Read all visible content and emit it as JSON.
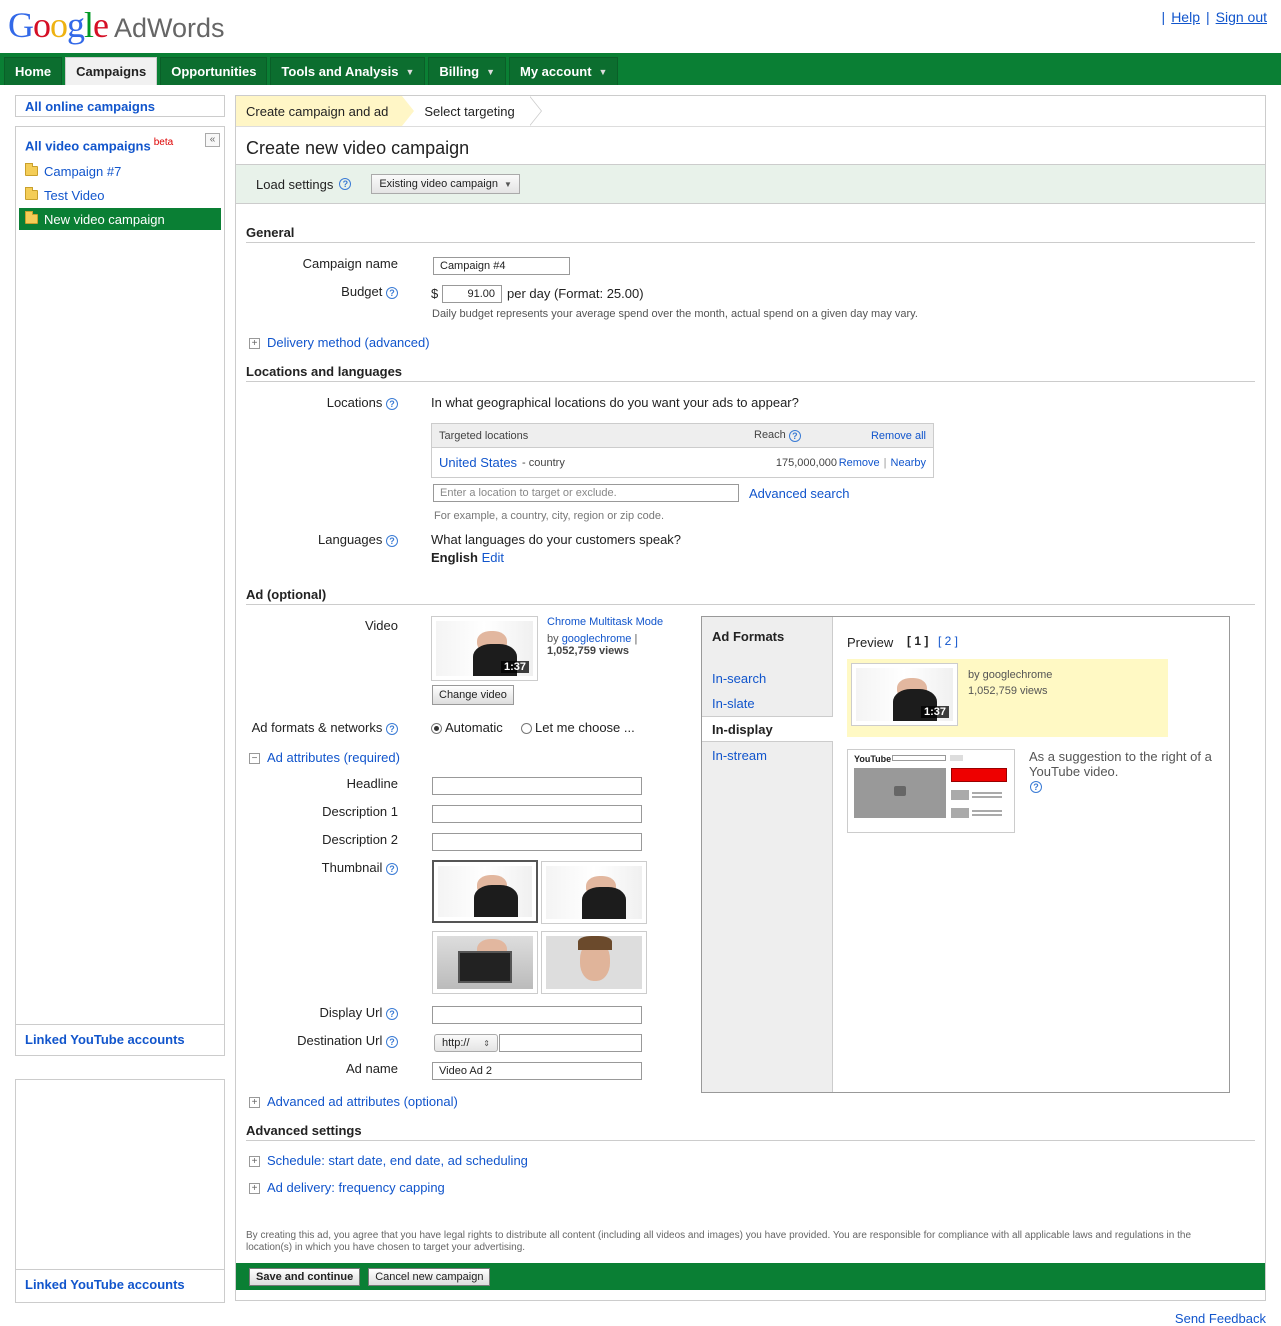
{
  "header": {
    "logo_google": "Google",
    "logo_product": "AdWords",
    "help": "Help",
    "signout": "Sign out"
  },
  "nav": {
    "tabs": [
      {
        "label": "Home"
      },
      {
        "label": "Campaigns"
      },
      {
        "label": "Opportunities"
      },
      {
        "label": "Tools and Analysis"
      },
      {
        "label": "Billing"
      },
      {
        "label": "My account"
      }
    ]
  },
  "sidebar": {
    "all_online": "All online campaigns",
    "all_video": "All video campaigns",
    "beta": "beta",
    "items": [
      {
        "label": "Campaign #7"
      },
      {
        "label": "Test Video"
      },
      {
        "label": "New video campaign"
      }
    ],
    "linked": "Linked YouTube accounts",
    "linked2": "Linked YouTube accounts"
  },
  "breadcrumbs": {
    "step1": "Create campaign and ad",
    "step2": "Select targeting"
  },
  "page": {
    "title": "Create new video campaign",
    "load_settings": "Load settings",
    "load_dropdown": "Existing video campaign"
  },
  "general": {
    "heading": "General",
    "campaign_name_label": "Campaign name",
    "campaign_name_value": "Campaign #4",
    "budget_label": "Budget",
    "currency": "$",
    "budget_value": "91.00",
    "budget_suffix": "per day (Format: 25.00)",
    "budget_note": "Daily budget represents your average spend over the month, actual spend on a given day may vary.",
    "delivery": "Delivery method (advanced)"
  },
  "locations": {
    "heading": "Locations and languages",
    "label": "Locations",
    "question": "In what geographical locations do you want your ads to appear?",
    "col_targeted": "Targeted locations",
    "col_reach": "Reach",
    "remove_all": "Remove all",
    "row_name": "United States",
    "row_type": "- country",
    "row_reach": "175,000,000",
    "remove": "Remove",
    "sep": "|",
    "nearby": "Nearby",
    "input_placeholder": "Enter a location to target or exclude.",
    "advanced_search": "Advanced search",
    "example": "For example, a country, city, region or zip code.",
    "languages_label": "Languages",
    "languages_question": "What languages do your customers speak?",
    "language": "English",
    "edit": "Edit"
  },
  "ad": {
    "heading": "Ad (optional)",
    "video_label": "Video",
    "video_title": "Chrome Multitask Mode",
    "by": "by",
    "channel": "googlechrome",
    "pipe": "|",
    "views": "1,052,759 views",
    "duration": "1:37",
    "change_video": "Change video",
    "formats_label": "Ad formats & networks",
    "automatic": "Automatic",
    "let_me_choose": "Let me choose ...",
    "attributes": "Ad attributes (required)",
    "headline_label": "Headline",
    "desc1_label": "Description 1",
    "desc2_label": "Description 2",
    "thumbnail_label": "Thumbnail",
    "display_url_label": "Display Url",
    "dest_url_label": "Destination Url",
    "protocol": "http://",
    "ad_name_label": "Ad name",
    "ad_name_value": "Video Ad 2",
    "advanced_attrs": "Advanced ad attributes (optional)"
  },
  "formats": {
    "heading": "Ad Formats",
    "items": [
      {
        "label": "In-search"
      },
      {
        "label": "In-slate"
      },
      {
        "label": "In-display"
      },
      {
        "label": "In-stream"
      }
    ],
    "preview": "Preview",
    "page1": "[ 1 ]",
    "page2": "[ 2 ]",
    "preview_by": "by googlechrome",
    "preview_views": "1,052,759 views",
    "preview_duration": "1:37",
    "suggestion": "As a suggestion to the right of a YouTube video.",
    "youtube": "YouTube"
  },
  "advanced": {
    "heading": "Advanced settings",
    "schedule": "Schedule: start date, end date, ad scheduling",
    "delivery": "Ad delivery: frequency capping"
  },
  "legal": "By creating this ad, you agree that you have legal rights to distribute all content (including all videos and images) you have provided. You are responsible for compliance with all applicable laws and regulations in the location(s) in which you have chosen to target your advertising.",
  "footer": {
    "save": "Save and continue",
    "cancel": "Cancel new campaign",
    "feedback": "Send Feedback"
  },
  "colors": {
    "green": "#0a7f34",
    "link": "#1155cc",
    "highlight": "#fff6c6"
  }
}
